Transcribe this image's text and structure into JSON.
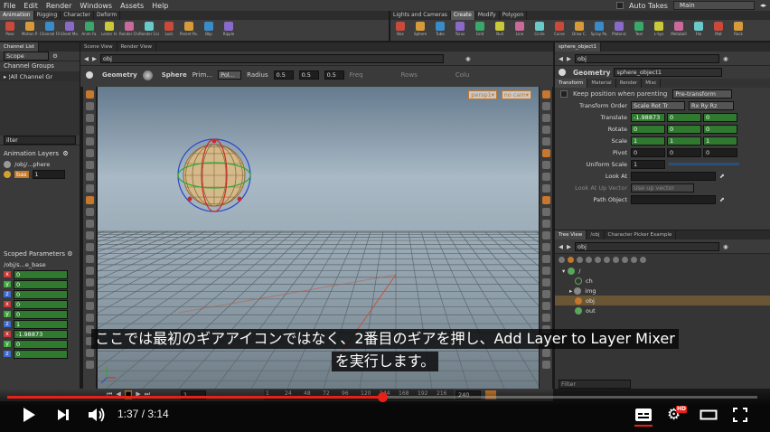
{
  "menu": {
    "items": [
      "File",
      "Edit",
      "Render",
      "Windows",
      "Assets",
      "Help"
    ],
    "auto_takes": "Auto Takes",
    "desktop": "Main"
  },
  "shelf": {
    "left_tabs": [
      "Animation",
      "Rigging",
      "Character",
      "Deform"
    ],
    "right_tabs": [
      "Lights and Cameras",
      "Create",
      "Modify",
      "Polygon"
    ],
    "left_tools": [
      "Pose",
      "Motion P.",
      "Channel Fil.",
      "Sheet Mo.",
      "Anim Fa.",
      "Lester H.",
      "Render Cha.",
      "Render Con.",
      "Lock",
      "Parent Pa.",
      "Bkp",
      "Ripple"
    ],
    "right_tools": [
      "Box",
      "Sphere",
      "Tube",
      "Torus",
      "Grid",
      "Null",
      "Line",
      "Circle",
      "Curve",
      "Draw C.",
      "Spray Pa.",
      "Platonic",
      "Text",
      "L-Sys",
      "Metaball",
      "File",
      "Mat",
      "Rock"
    ]
  },
  "left_panel": {
    "tabs": [
      "Channel List",
      "Scene View",
      "Render View"
    ],
    "scope": "Scope",
    "channel_groups": "Channel Groups",
    "all_channels": "All Channel Gr",
    "filter": "ilter",
    "animation_layers": "Animation Layers",
    "layers": [
      {
        "name": "/obj/...phere",
        "value": ""
      },
      {
        "name": "bas",
        "value": "1"
      }
    ],
    "scoped_parameters": "Scoped Parameters",
    "scoped_path": "/obj/s...e_base",
    "scoped_rows": [
      {
        "axis": "x",
        "value": "0",
        "color": "#c73a3a"
      },
      {
        "axis": "y",
        "value": "0",
        "color": "#3fa63f"
      },
      {
        "axis": "z",
        "value": "0",
        "color": "#3f6bd0"
      },
      {
        "axis": "x",
        "value": "0",
        "color": "#c73a3a"
      },
      {
        "axis": "y",
        "value": "0",
        "color": "#3fa63f"
      },
      {
        "axis": "z",
        "value": "1",
        "color": "#3f6bd0"
      },
      {
        "axis": "x",
        "value": "-1.98873",
        "color": "#c73a3a"
      },
      {
        "axis": "y",
        "value": "0",
        "color": "#3fa63f"
      },
      {
        "axis": "z",
        "value": "0",
        "color": "#3f6bd0"
      }
    ]
  },
  "viewport": {
    "path": "obj",
    "geometry": "Geometry",
    "sphere": "Sphere",
    "prim": "Prim...",
    "poly": "Pol...",
    "radius_label": "Radius",
    "radius": [
      "0.5",
      "0.5",
      "0.5"
    ],
    "freq": "Freq",
    "rows": "Rows",
    "cols": "Colu",
    "persp": "persp1▾",
    "nocam": "no cam▾"
  },
  "params": {
    "tabs": [
      "sphere_object1"
    ],
    "path": "obj",
    "node_type": "Geometry",
    "node_name": "sphere_object1",
    "sub_tabs": [
      "Transform",
      "Material",
      "Render",
      "Misc"
    ],
    "keep_position": "Keep position when parenting",
    "pre_transform": "Pre-transform",
    "transform_order_label": "Transform Order",
    "transform_order": "Scale Rot Tr",
    "rot_order": "Rx Ry Rz",
    "rows": [
      {
        "label": "Translate",
        "values": [
          "-1.98873",
          "0",
          "0"
        ],
        "green": [
          true,
          true,
          true
        ]
      },
      {
        "label": "Rotate",
        "values": [
          "0",
          "0",
          "0"
        ],
        "green": [
          true,
          true,
          true
        ]
      },
      {
        "label": "Scale",
        "values": [
          "1",
          "1",
          "1"
        ],
        "green": [
          true,
          true,
          true
        ]
      },
      {
        "label": "Pivot",
        "values": [
          "0",
          "0",
          "0"
        ],
        "green": [
          false,
          false,
          false
        ]
      }
    ],
    "uniform_scale_label": "Uniform Scale",
    "uniform_scale": "1",
    "look_at": "Look At",
    "look_at_up": "Look At Up Vector",
    "up_vector": "Use up vector",
    "path_object": "Path Object"
  },
  "network": {
    "tabs": [
      "Tree View",
      "/obj",
      "Character Picker Example"
    ],
    "path": "obj",
    "root": "/",
    "nodes": [
      "ch",
      "img",
      "obj",
      "out"
    ],
    "filter": "Filter"
  },
  "timeline": {
    "frames": [
      "1",
      "24",
      "48",
      "72",
      "96",
      "120",
      "144",
      "168",
      "192",
      "216"
    ],
    "current": "1",
    "end": "240"
  },
  "subtitle": {
    "line1": "ここでは最初のギアアイコンではなく、2番目のギアを押し、Add Layer to Layer Mixer",
    "line2": "を実行します。"
  },
  "player": {
    "time_current": "1:37",
    "time_total": "3:14",
    "progress": 0.5,
    "hd": "HD"
  }
}
